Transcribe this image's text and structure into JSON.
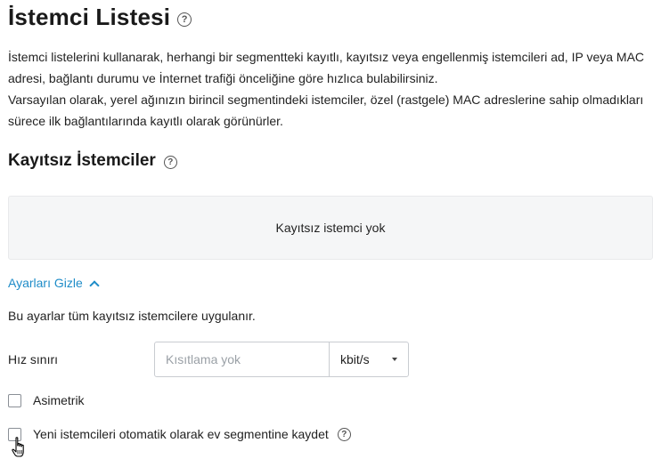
{
  "page": {
    "title": "İstemci Listesi",
    "help_icon": "question-circle-icon",
    "description_1": "İstemci listelerini kullanarak, herhangi bir segmentteki kayıtlı, kayıtsız veya engellenmiş istemcileri ad, IP veya MAC adresi, bağlantı durumu ve İnternet trafiği önceliğine göre hızlıca bulabilirsiniz.",
    "description_2": "Varsayılan olarak, yerel ağınızın birincil segmentindeki istemciler, özel (rastgele) MAC adreslerine sahip olmadıkları sürece ilk bağlantılarında kayıtlı olarak görünürler."
  },
  "unregistered": {
    "title": "Kayıtsız İstemciler",
    "empty_text": "Kayıtsız istemci yok",
    "toggle_label": "Ayarları Gizle",
    "settings_note": "Bu ayarlar tüm kayıtsız istemcilere uygulanır.",
    "speed_limit_label": "Hız sınırı",
    "speed_limit_placeholder": "Kısıtlama yok",
    "speed_limit_value": "",
    "unit_selected": "kbit/s",
    "asymmetric_label": "Asimetrik",
    "asymmetric_checked": false,
    "auto_save_label": "Yeni istemcileri otomatik olarak ev segmentine kaydet",
    "auto_save_checked": false
  },
  "colors": {
    "link": "#1e8cc8",
    "empty_box_bg": "#f5f6f7"
  }
}
